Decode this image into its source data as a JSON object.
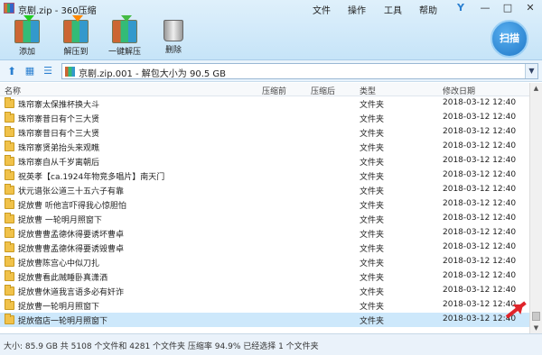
{
  "window": {
    "title": "京剧.zip - 360压缩",
    "menus": [
      "文件",
      "操作",
      "工具",
      "帮助"
    ],
    "controls": [
      "Y",
      "—",
      "□",
      "✕"
    ]
  },
  "toolbar": {
    "add_label": "添加",
    "extract_to_label": "解压到",
    "one_click_extract_label": "一键解压",
    "delete_label": "删除",
    "scan_label": "扫描"
  },
  "address": {
    "path_text": "京剧.zip.001 - 解包大小为 90.5 GB"
  },
  "columns": {
    "name": "名称",
    "compressed_before": "压缩前",
    "compressed_after": "压缩后",
    "type": "类型",
    "modified": "修改日期"
  },
  "rows": [
    {
      "name": "珠帘寨太保推杯换大斗",
      "type": "文件夹",
      "modified": "2018-03-12 12:40"
    },
    {
      "name": "珠帘寨昔日有个三大贤",
      "type": "文件夹",
      "modified": "2018-03-12 12:40"
    },
    {
      "name": "珠帘寨昔日有个三大贤",
      "type": "文件夹",
      "modified": "2018-03-12 12:40"
    },
    {
      "name": "珠帘寨贤弟抬头来观瞧",
      "type": "文件夹",
      "modified": "2018-03-12 12:40"
    },
    {
      "name": "珠帘寨自从千岁离朝后",
      "type": "文件夹",
      "modified": "2018-03-12 12:40"
    },
    {
      "name": "祝英孝【ca.1924年物竞多唱片】南天门",
      "type": "文件夹",
      "modified": "2018-03-12 12:40"
    },
    {
      "name": "状元谱张公道三十五六子有靠",
      "type": "文件夹",
      "modified": "2018-03-12 12:40"
    },
    {
      "name": "捉放曹 听他言吓得我心惊胆怕",
      "type": "文件夹",
      "modified": "2018-03-12 12:40"
    },
    {
      "name": "捉放曹 一轮明月照窗下",
      "type": "文件夹",
      "modified": "2018-03-12 12:40"
    },
    {
      "name": "捉放曹曹孟德休得要诱坏曹卓",
      "type": "文件夹",
      "modified": "2018-03-12 12:40"
    },
    {
      "name": "捉放曹曹孟德休得要诱毁曹卓",
      "type": "文件夹",
      "modified": "2018-03-12 12:40"
    },
    {
      "name": "捉放曹陈宫心中似刀扎",
      "type": "文件夹",
      "modified": "2018-03-12 12:40"
    },
    {
      "name": "捉放曹看此贼睡卧真潇洒",
      "type": "文件夹",
      "modified": "2018-03-12 12:40"
    },
    {
      "name": "捉放曹休道我言语多必有奸诈",
      "type": "文件夹",
      "modified": "2018-03-12 12:40"
    },
    {
      "name": "捉放曹一轮明月照窗下",
      "type": "文件夹",
      "modified": "2018-03-12 12:40"
    },
    {
      "name": "捉放宿店一轮明月照窗下",
      "type": "文件夹",
      "modified": "2018-03-12 12:40"
    }
  ],
  "status": {
    "text": "大小: 85.9 GB 共 5108 个文件和 4281 个文件夹 压缩率 94.9% 已经选择 1 个文件夹"
  }
}
